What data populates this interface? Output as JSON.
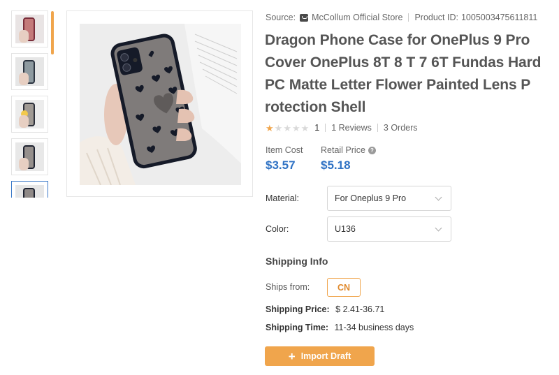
{
  "thumbnails": [
    {
      "variant": "leopard"
    },
    {
      "variant": "floral"
    },
    {
      "variant": "smiley"
    },
    {
      "variant": "letter"
    },
    {
      "variant": "hearts",
      "active": true
    }
  ],
  "product": {
    "source_label": "Source:",
    "store_name": "McCollum Official Store",
    "product_id_label": "Product ID:",
    "product_id": "1005003475611811",
    "title": "Dragon Phone Case for OnePlus 9 Pro Cover OnePlus 8T 8 T 7 6T Fundas Hard PC Matte Letter Flower Painted Lens P rotection Shell",
    "rating_value": 1,
    "rating_text": "1",
    "reviews": "1 Reviews",
    "orders": "3 Orders"
  },
  "pricing": {
    "item_cost_label": "Item Cost",
    "item_cost": "$3.57",
    "retail_price_label": "Retail Price",
    "retail_price": "$5.18"
  },
  "options": {
    "material_label": "Material:",
    "material_value": "For Oneplus 9 Pro",
    "color_label": "Color:",
    "color_value": "U136"
  },
  "shipping": {
    "heading": "Shipping Info",
    "ships_from_label": "Ships from:",
    "ships_from_value": "CN",
    "price_label": "Shipping Price:",
    "price_value": "$ 2.41-36.71",
    "time_label": "Shipping Time:",
    "time_value": "11-34 business days"
  },
  "actions": {
    "import_label": "Import Draft"
  },
  "colors": {
    "accent_orange": "#f0a54c",
    "price_blue": "#2f72c4"
  },
  "icons": [
    "store-icon",
    "star-icon",
    "help-icon",
    "chevron-down-icon",
    "plus-icon"
  ]
}
